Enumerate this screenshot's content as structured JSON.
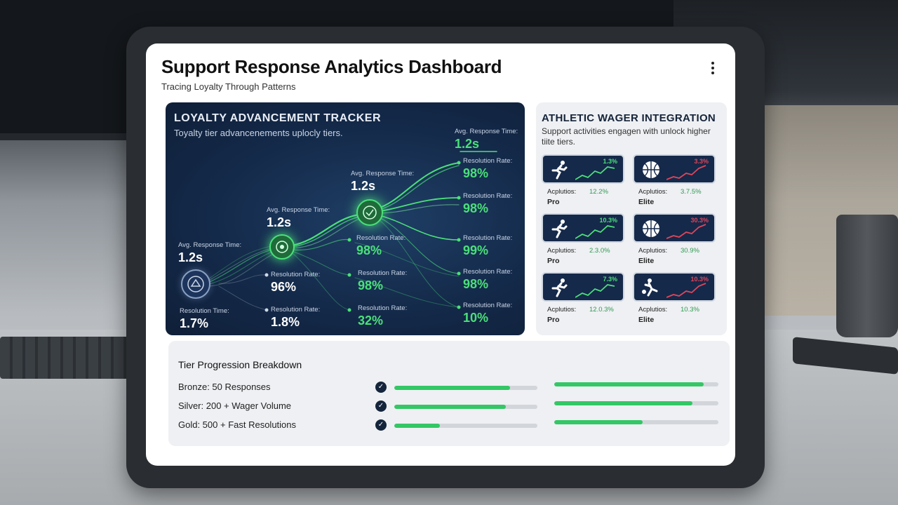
{
  "app": {
    "title": "Support Response Analytics Dashboard",
    "subtitle": "Tracing Loyalty Through Patterns",
    "more_icon": "more-vertical-icon"
  },
  "colors": {
    "accent_green": "#4be07a",
    "panel_navy": "#142a4a",
    "negative_red": "#e0455a"
  },
  "tracker": {
    "title": "LOYALTY ADVANCEMENT TRACKER",
    "description": "Toyalty tier advancenements uplocly tiers.",
    "metrics": [
      {
        "label": "Avg. Response Time:",
        "value": "1.2s"
      },
      {
        "label": "Resolution Time:",
        "value": "1.7%"
      },
      {
        "label": "Avg. Response Time:",
        "value": "1.2s"
      },
      {
        "label": "Resolution Rate:",
        "value": "96%"
      },
      {
        "label": "Resolution Rate:",
        "value": "1.8%"
      },
      {
        "label": "Avg. Response Time:",
        "value": "1.2s"
      },
      {
        "label": "Resolution Rate:",
        "value": "98%"
      },
      {
        "label": "Resolution Rate:",
        "value": "98%"
      },
      {
        "label": "Resolution Rate:",
        "value": "32%"
      },
      {
        "label": "Avg. Response Time:",
        "value": "1.2s"
      },
      {
        "label": "Resolution Rate:",
        "value": "98%"
      },
      {
        "label": "Resolution Rate:",
        "value": "98%"
      },
      {
        "label": "Resolution Rate:",
        "value": "99%"
      },
      {
        "label": "Resolution Rate:",
        "value": "98%"
      },
      {
        "label": "Resolution Rate:",
        "value": "10%"
      }
    ]
  },
  "athletic": {
    "title": "ATHLETIC WAGER INTEGRATION",
    "description": "Support activities engagen with unlock higher tiite tiers.",
    "cards": [
      {
        "icon": "runner-icon",
        "pct": "1.3%",
        "trend": "up",
        "meta_key": "Acplutios:",
        "meta_val": "12.2%",
        "tier": "Pro"
      },
      {
        "icon": "basketball-icon",
        "pct": "3.3%",
        "trend": "down",
        "meta_key": "Acplutios:",
        "meta_val": "3.7.5%",
        "tier": "Elite"
      },
      {
        "icon": "runner-icon",
        "pct": "10.3%",
        "trend": "up",
        "meta_key": "Acplutios:",
        "meta_val": "2.3.0%",
        "tier": "Pro"
      },
      {
        "icon": "basketball-icon",
        "pct": "30.3%",
        "trend": "down",
        "meta_key": "Acplutios:",
        "meta_val": "30.9%",
        "tier": "Elite"
      },
      {
        "icon": "runner-icon",
        "pct": "7.3%",
        "trend": "up",
        "meta_key": "Acplutios:",
        "meta_val": "12.0.3%",
        "tier": "Pro"
      },
      {
        "icon": "soccer-player-icon",
        "pct": "10.3%",
        "trend": "down",
        "meta_key": "Acplutios:",
        "meta_val": "10.3%",
        "tier": "Elite"
      }
    ]
  },
  "tiers": {
    "title": "Tier Progression Breakdown",
    "rows": [
      {
        "label": "Bronze: 50 Responses",
        "progress_a": 0.81,
        "progress_b": 0.91
      },
      {
        "label": "Silver: 200 + Wager Volume",
        "progress_a": 0.78,
        "progress_b": 0.84
      },
      {
        "label": "Gold: 500 + Fast Resolutions",
        "progress_a": 0.32,
        "progress_b": 0.54
      }
    ]
  }
}
